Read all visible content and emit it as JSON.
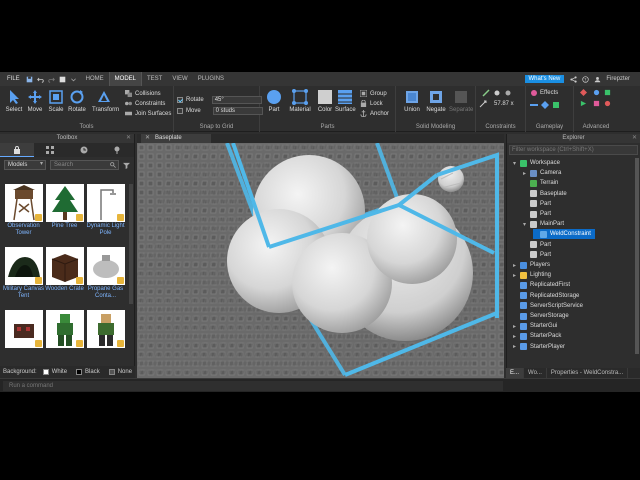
{
  "menubar": {
    "file": "FILE",
    "tabs": [
      "HOME",
      "MODEL",
      "TEST",
      "VIEW",
      "PLUGINS"
    ],
    "active_tab": "MODEL",
    "whats_new": "What's New",
    "user": "Firepzter"
  },
  "ribbon": {
    "tools": {
      "select": "Select",
      "move": "Move",
      "scale": "Scale",
      "rotate": "Rotate",
      "transform": "Transform",
      "collisions": "Collisions",
      "constraints": "Constraints",
      "join_surfaces": "Join Surfaces",
      "label": "Tools"
    },
    "snap": {
      "rotate_label": "Rotate",
      "rotate_value": "45°",
      "move_label": "Move",
      "move_value": "0 studs",
      "label": "Snap to Grid"
    },
    "parts": {
      "part": "Part",
      "material": "Material",
      "color": "Color",
      "surface": "Surface",
      "group": "Group",
      "lock": "Lock",
      "anchor": "Anchor",
      "label": "Parts"
    },
    "solid": {
      "union": "Union",
      "negate": "Negate",
      "separate": "Separate",
      "label": "Solid Modeling"
    },
    "constraints": {
      "value": "57.87 x",
      "label": "Constraints"
    },
    "gameplay": {
      "effects": "Effects",
      "label": "Gameplay"
    },
    "advanced": {
      "label": "Advanced"
    }
  },
  "toolbox": {
    "title": "Toolbox",
    "category": "Models",
    "search_placeholder": "Search",
    "assets": [
      {
        "name": "Observation Tower"
      },
      {
        "name": "Pine Tree"
      },
      {
        "name": "Dynamic Light Pole"
      },
      {
        "name": "Military Canvas Tent"
      },
      {
        "name": "Wooden Crate"
      },
      {
        "name": "Propane Gas Conta..."
      },
      {
        "name": ""
      },
      {
        "name": ""
      },
      {
        "name": ""
      }
    ],
    "background_label": "Background:",
    "bg_white": "White",
    "bg_black": "Black",
    "bg_none": "None"
  },
  "viewport": {
    "tab": "Baseplate"
  },
  "explorer": {
    "title": "Explorer",
    "filter_placeholder": "Filter workspace (Ctrl+Shift+X)",
    "items": [
      {
        "label": "Workspace",
        "icon_color": "#3ac26a"
      },
      {
        "label": "Camera",
        "icon_color": "#6a8fc6"
      },
      {
        "label": "Terrain",
        "icon_color": "#4caf50"
      },
      {
        "label": "Baseplate",
        "icon_color": "#c9c9c9"
      },
      {
        "label": "Part",
        "icon_color": "#c9c9c9"
      },
      {
        "label": "Part",
        "icon_color": "#c9c9c9"
      },
      {
        "label": "MainPart",
        "icon_color": "#c9c9c9"
      },
      {
        "label": "WeldConstraint",
        "icon_color": "#5fa8e8"
      },
      {
        "label": "Part",
        "icon_color": "#c9c9c9"
      },
      {
        "label": "Part",
        "icon_color": "#c9c9c9"
      },
      {
        "label": "Players",
        "icon_color": "#4a8fe0"
      },
      {
        "label": "Lighting",
        "icon_color": "#f0c040"
      },
      {
        "label": "ReplicatedFirst",
        "icon_color": "#5a9be8"
      },
      {
        "label": "ReplicatedStorage",
        "icon_color": "#5a9be8"
      },
      {
        "label": "ServerScriptService",
        "icon_color": "#5a9be8"
      },
      {
        "label": "ServerStorage",
        "icon_color": "#5a9be8"
      },
      {
        "label": "StarterGui",
        "icon_color": "#5a9be8"
      },
      {
        "label": "StarterPack",
        "icon_color": "#5a9be8"
      },
      {
        "label": "StarterPlayer",
        "icon_color": "#5a9be8"
      }
    ],
    "bottom_tabs": [
      "E...",
      "Wo...",
      "Properties - WeldConstra..."
    ]
  },
  "command_bar": {
    "placeholder": "Run a command"
  }
}
